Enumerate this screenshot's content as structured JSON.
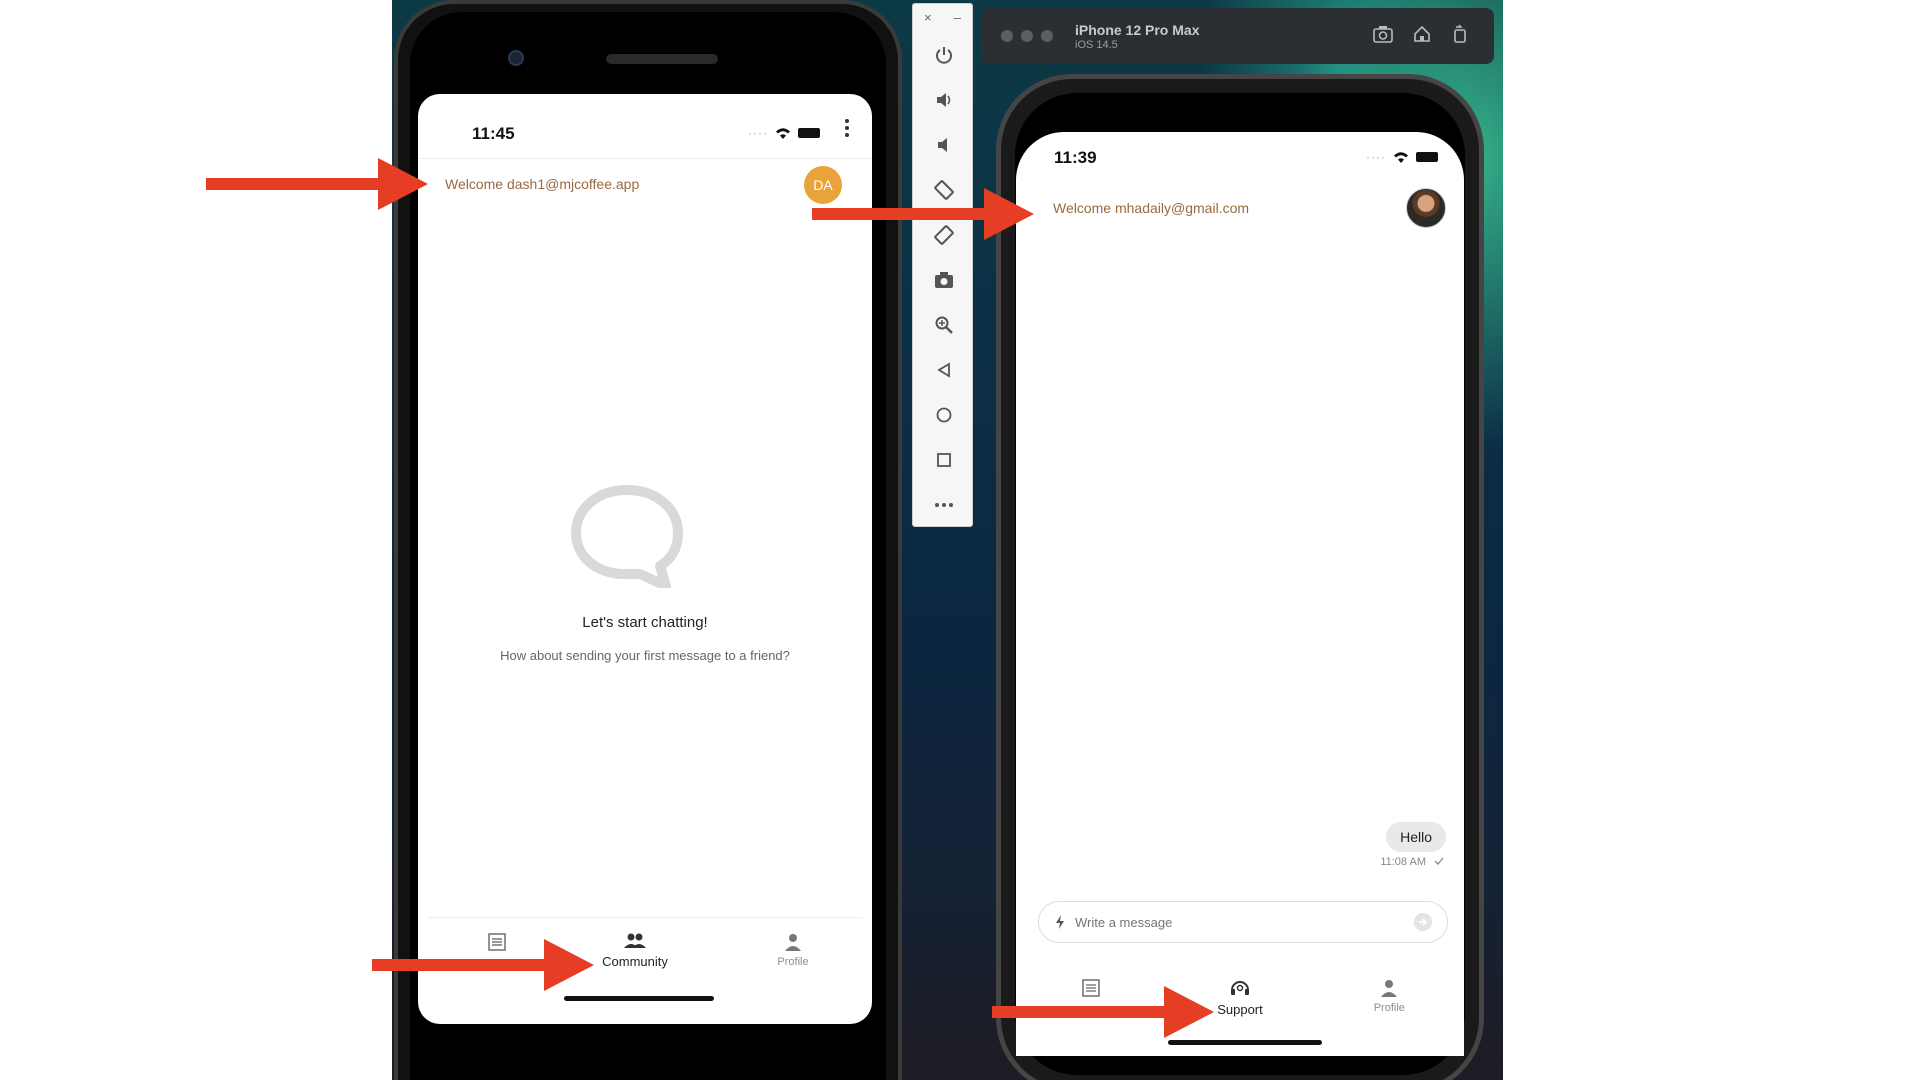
{
  "android": {
    "time": "11:45",
    "welcome_text": "Welcome dash1@mjcoffee.app",
    "avatar_initials": "DA",
    "empty_title": "Let's start chatting!",
    "empty_subtitle": "How about sending your first message to a friend?",
    "tabs": [
      {
        "label": "",
        "icon": "list-icon"
      },
      {
        "label": "Community",
        "icon": "community-icon",
        "active": true
      },
      {
        "label": "Profile",
        "icon": "profile-icon"
      }
    ]
  },
  "emulator_toolbar": {
    "close": "×",
    "minimize": "–",
    "buttons": [
      "power-icon",
      "volume-up-icon",
      "volume-down-icon",
      "rotate-left-icon",
      "rotate-right-icon",
      "camera-icon",
      "zoom-icon",
      "back-icon",
      "home-icon",
      "overview-icon",
      "more-icon"
    ]
  },
  "simulator": {
    "device_name": "iPhone 12 Pro Max",
    "os_version": "iOS 14.5"
  },
  "iphone": {
    "time": "11:39",
    "welcome_text": "Welcome mhadaily@gmail.com",
    "message": {
      "text": "Hello",
      "time": "11:08 AM"
    },
    "composer_placeholder": "Write a message",
    "tabs": [
      {
        "label": "",
        "icon": "list-icon"
      },
      {
        "label": "Support",
        "icon": "support-icon",
        "active": true
      },
      {
        "label": "Profile",
        "icon": "profile-icon"
      }
    ]
  },
  "colors": {
    "accent_brown": "#9b6a3c",
    "avatar_orange": "#e8a33a",
    "arrow_red": "#e63d25"
  }
}
